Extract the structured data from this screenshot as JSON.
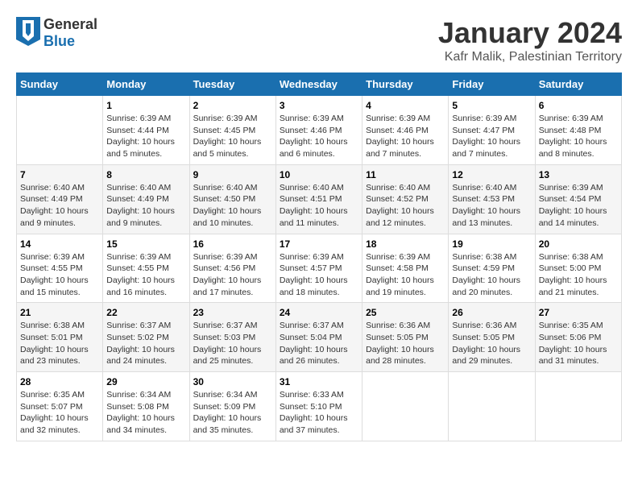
{
  "logo": {
    "general": "General",
    "blue": "Blue"
  },
  "title": "January 2024",
  "subtitle": "Kafr Malik, Palestinian Territory",
  "weekdays": [
    "Sunday",
    "Monday",
    "Tuesday",
    "Wednesday",
    "Thursday",
    "Friday",
    "Saturday"
  ],
  "weeks": [
    [
      {
        "day": "",
        "sunrise": "",
        "sunset": "",
        "daylight": ""
      },
      {
        "day": "1",
        "sunrise": "Sunrise: 6:39 AM",
        "sunset": "Sunset: 4:44 PM",
        "daylight": "Daylight: 10 hours and 5 minutes."
      },
      {
        "day": "2",
        "sunrise": "Sunrise: 6:39 AM",
        "sunset": "Sunset: 4:45 PM",
        "daylight": "Daylight: 10 hours and 5 minutes."
      },
      {
        "day": "3",
        "sunrise": "Sunrise: 6:39 AM",
        "sunset": "Sunset: 4:46 PM",
        "daylight": "Daylight: 10 hours and 6 minutes."
      },
      {
        "day": "4",
        "sunrise": "Sunrise: 6:39 AM",
        "sunset": "Sunset: 4:46 PM",
        "daylight": "Daylight: 10 hours and 7 minutes."
      },
      {
        "day": "5",
        "sunrise": "Sunrise: 6:39 AM",
        "sunset": "Sunset: 4:47 PM",
        "daylight": "Daylight: 10 hours and 7 minutes."
      },
      {
        "day": "6",
        "sunrise": "Sunrise: 6:39 AM",
        "sunset": "Sunset: 4:48 PM",
        "daylight": "Daylight: 10 hours and 8 minutes."
      }
    ],
    [
      {
        "day": "7",
        "sunrise": "Sunrise: 6:40 AM",
        "sunset": "Sunset: 4:49 PM",
        "daylight": "Daylight: 10 hours and 9 minutes."
      },
      {
        "day": "8",
        "sunrise": "Sunrise: 6:40 AM",
        "sunset": "Sunset: 4:49 PM",
        "daylight": "Daylight: 10 hours and 9 minutes."
      },
      {
        "day": "9",
        "sunrise": "Sunrise: 6:40 AM",
        "sunset": "Sunset: 4:50 PM",
        "daylight": "Daylight: 10 hours and 10 minutes."
      },
      {
        "day": "10",
        "sunrise": "Sunrise: 6:40 AM",
        "sunset": "Sunset: 4:51 PM",
        "daylight": "Daylight: 10 hours and 11 minutes."
      },
      {
        "day": "11",
        "sunrise": "Sunrise: 6:40 AM",
        "sunset": "Sunset: 4:52 PM",
        "daylight": "Daylight: 10 hours and 12 minutes."
      },
      {
        "day": "12",
        "sunrise": "Sunrise: 6:40 AM",
        "sunset": "Sunset: 4:53 PM",
        "daylight": "Daylight: 10 hours and 13 minutes."
      },
      {
        "day": "13",
        "sunrise": "Sunrise: 6:39 AM",
        "sunset": "Sunset: 4:54 PM",
        "daylight": "Daylight: 10 hours and 14 minutes."
      }
    ],
    [
      {
        "day": "14",
        "sunrise": "Sunrise: 6:39 AM",
        "sunset": "Sunset: 4:55 PM",
        "daylight": "Daylight: 10 hours and 15 minutes."
      },
      {
        "day": "15",
        "sunrise": "Sunrise: 6:39 AM",
        "sunset": "Sunset: 4:55 PM",
        "daylight": "Daylight: 10 hours and 16 minutes."
      },
      {
        "day": "16",
        "sunrise": "Sunrise: 6:39 AM",
        "sunset": "Sunset: 4:56 PM",
        "daylight": "Daylight: 10 hours and 17 minutes."
      },
      {
        "day": "17",
        "sunrise": "Sunrise: 6:39 AM",
        "sunset": "Sunset: 4:57 PM",
        "daylight": "Daylight: 10 hours and 18 minutes."
      },
      {
        "day": "18",
        "sunrise": "Sunrise: 6:39 AM",
        "sunset": "Sunset: 4:58 PM",
        "daylight": "Daylight: 10 hours and 19 minutes."
      },
      {
        "day": "19",
        "sunrise": "Sunrise: 6:38 AM",
        "sunset": "Sunset: 4:59 PM",
        "daylight": "Daylight: 10 hours and 20 minutes."
      },
      {
        "day": "20",
        "sunrise": "Sunrise: 6:38 AM",
        "sunset": "Sunset: 5:00 PM",
        "daylight": "Daylight: 10 hours and 21 minutes."
      }
    ],
    [
      {
        "day": "21",
        "sunrise": "Sunrise: 6:38 AM",
        "sunset": "Sunset: 5:01 PM",
        "daylight": "Daylight: 10 hours and 23 minutes."
      },
      {
        "day": "22",
        "sunrise": "Sunrise: 6:37 AM",
        "sunset": "Sunset: 5:02 PM",
        "daylight": "Daylight: 10 hours and 24 minutes."
      },
      {
        "day": "23",
        "sunrise": "Sunrise: 6:37 AM",
        "sunset": "Sunset: 5:03 PM",
        "daylight": "Daylight: 10 hours and 25 minutes."
      },
      {
        "day": "24",
        "sunrise": "Sunrise: 6:37 AM",
        "sunset": "Sunset: 5:04 PM",
        "daylight": "Daylight: 10 hours and 26 minutes."
      },
      {
        "day": "25",
        "sunrise": "Sunrise: 6:36 AM",
        "sunset": "Sunset: 5:05 PM",
        "daylight": "Daylight: 10 hours and 28 minutes."
      },
      {
        "day": "26",
        "sunrise": "Sunrise: 6:36 AM",
        "sunset": "Sunset: 5:05 PM",
        "daylight": "Daylight: 10 hours and 29 minutes."
      },
      {
        "day": "27",
        "sunrise": "Sunrise: 6:35 AM",
        "sunset": "Sunset: 5:06 PM",
        "daylight": "Daylight: 10 hours and 31 minutes."
      }
    ],
    [
      {
        "day": "28",
        "sunrise": "Sunrise: 6:35 AM",
        "sunset": "Sunset: 5:07 PM",
        "daylight": "Daylight: 10 hours and 32 minutes."
      },
      {
        "day": "29",
        "sunrise": "Sunrise: 6:34 AM",
        "sunset": "Sunset: 5:08 PM",
        "daylight": "Daylight: 10 hours and 34 minutes."
      },
      {
        "day": "30",
        "sunrise": "Sunrise: 6:34 AM",
        "sunset": "Sunset: 5:09 PM",
        "daylight": "Daylight: 10 hours and 35 minutes."
      },
      {
        "day": "31",
        "sunrise": "Sunrise: 6:33 AM",
        "sunset": "Sunset: 5:10 PM",
        "daylight": "Daylight: 10 hours and 37 minutes."
      },
      {
        "day": "",
        "sunrise": "",
        "sunset": "",
        "daylight": ""
      },
      {
        "day": "",
        "sunrise": "",
        "sunset": "",
        "daylight": ""
      },
      {
        "day": "",
        "sunrise": "",
        "sunset": "",
        "daylight": ""
      }
    ]
  ]
}
